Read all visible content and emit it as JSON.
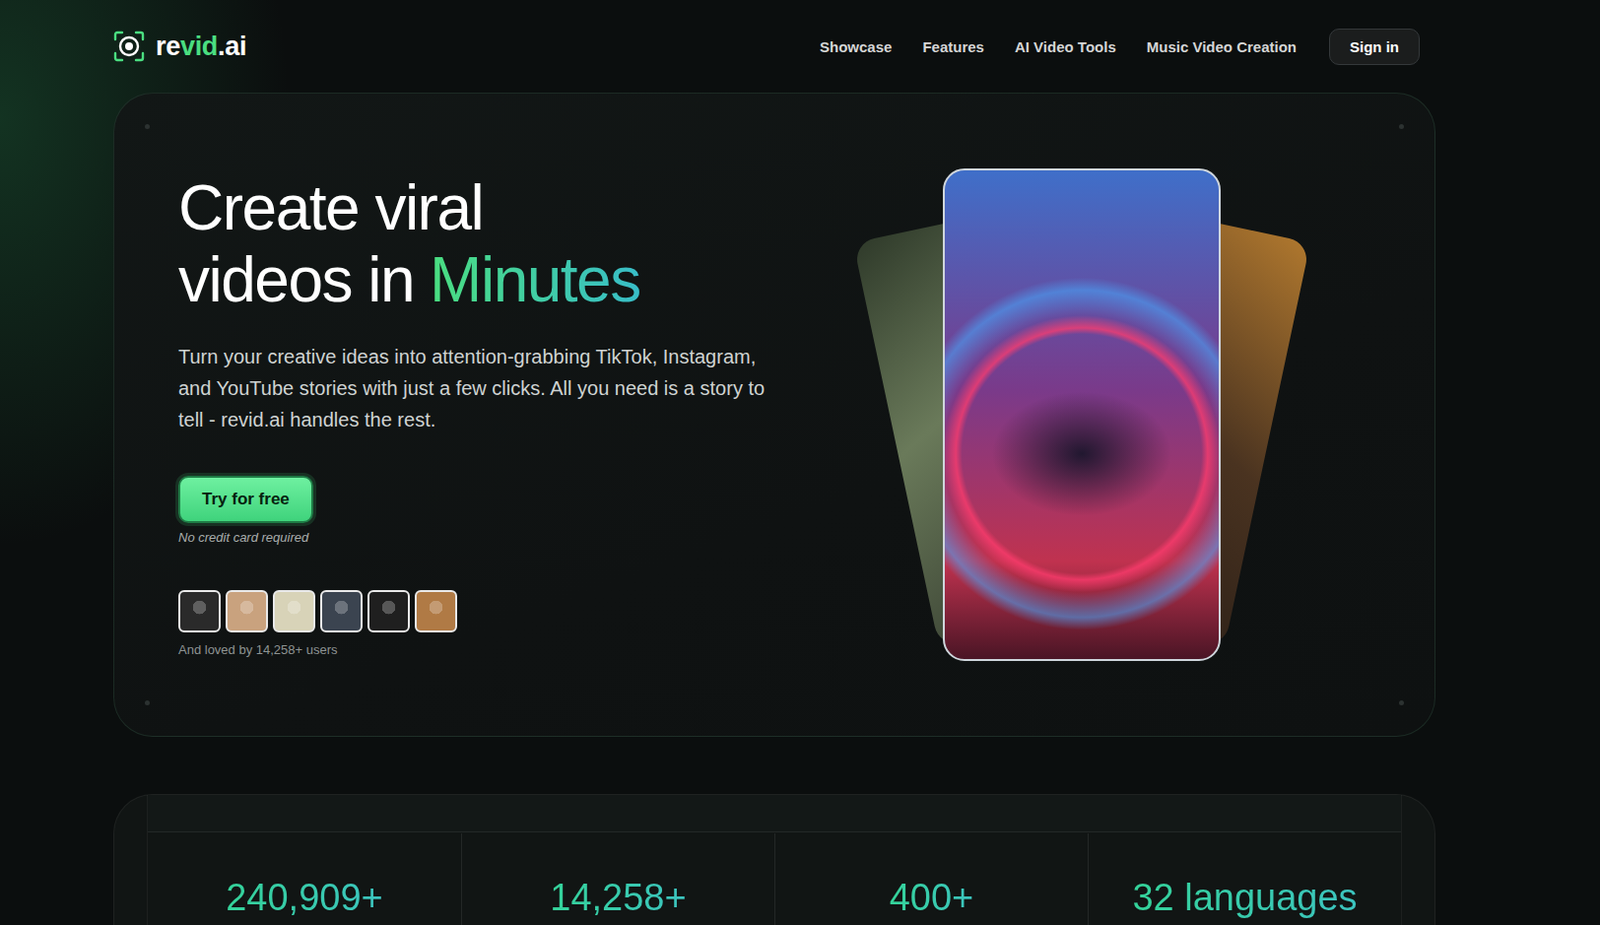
{
  "nav": {
    "logo": [
      {
        "text": "re",
        "accent": false
      },
      {
        "text": "vid",
        "accent": true
      },
      {
        "text": ".ai",
        "accent": false
      }
    ],
    "links": [
      "Showcase",
      "Features",
      "AI Video Tools",
      "Music Video Creation"
    ],
    "signIn": "Sign in"
  },
  "hero": {
    "headline": "Create viral",
    "headline2": "videos in",
    "accent": "Minutes",
    "description": "Turn your creative ideas into attention-grabbing TikTok, Instagram, and YouTube stories with just a few clicks. All you need is a story to tell - revid.ai handles the rest.",
    "cta": "Try for free",
    "note": "No credit card required",
    "avatars": [
      {
        "color": "#2a2a2a"
      },
      {
        "color": "#c9a27e"
      },
      {
        "color": "#d8d3b8"
      },
      {
        "color": "#3b4450"
      },
      {
        "color": "#1f1f1f"
      },
      {
        "color": "#b07a45"
      }
    ],
    "social": "And loved by 14,258+ users"
  },
  "stats": [
    "240,909+",
    "14,258+",
    "400+",
    "32 languages"
  ]
}
